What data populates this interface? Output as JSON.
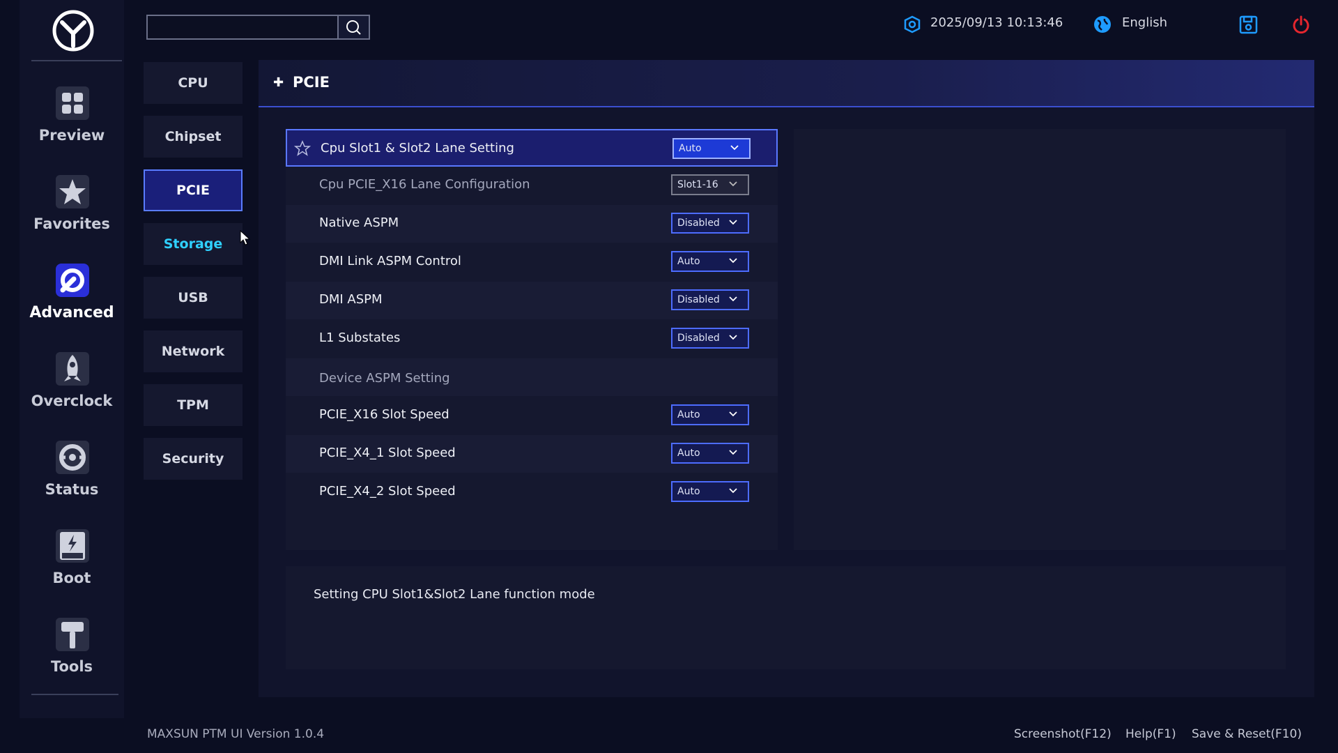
{
  "topbar": {
    "search_placeholder": "",
    "datetime": "2025/09/13 10:13:46",
    "language": "English"
  },
  "nav": [
    {
      "label": "Preview",
      "icon": "preview-grid-icon"
    },
    {
      "label": "Favorites",
      "icon": "favorites-star-icon"
    },
    {
      "label": "Advanced",
      "icon": "advanced-wrench-icon",
      "active": true
    },
    {
      "label": "Overclock",
      "icon": "overclock-rocket-icon"
    },
    {
      "label": "Status",
      "icon": "status-gauge-icon"
    },
    {
      "label": "Boot",
      "icon": "boot-ssd-icon"
    },
    {
      "label": "Tools",
      "icon": "tools-hammer-icon"
    }
  ],
  "submenu": [
    "CPU",
    "Chipset",
    "PCIE",
    "Storage",
    "USB",
    "Network",
    "TPM",
    "Security"
  ],
  "panel": {
    "title": "PCIE",
    "rows": [
      {
        "name": "Cpu Slot1 & Slot2 Lane Setting",
        "value": "Auto"
      },
      {
        "name": "Cpu PCIE_X16 Lane Configuration",
        "value": "Slot1-16"
      },
      {
        "name": "Native ASPM",
        "value": "Disabled"
      },
      {
        "name": "DMI Link ASPM Control",
        "value": "Auto"
      },
      {
        "name": "DMI ASPM",
        "value": "Disabled"
      },
      {
        "name": "L1 Substates",
        "value": "Disabled"
      },
      {
        "name": "Device ASPM Setting",
        "value": ""
      },
      {
        "name": "PCIE_X16 Slot Speed",
        "value": "Auto"
      },
      {
        "name": "PCIE_X4_1 Slot Speed",
        "value": "Auto"
      },
      {
        "name": "PCIE_X4_2 Slot Speed",
        "value": "Auto"
      }
    ],
    "help": "Setting CPU Slot1&Slot2 Lane function mode"
  },
  "footer": {
    "version": "MAXSUN PTM UI Version 1.0.4",
    "screenshot": "Screenshot(F12)",
    "help": "Help(F1)",
    "save": "Save & Reset(F10)"
  },
  "colors": {
    "accent": "#4d6cff",
    "hover_text": "#2fd0ff",
    "power": "#e5262e",
    "topbar_icon": "#1e9bff"
  }
}
